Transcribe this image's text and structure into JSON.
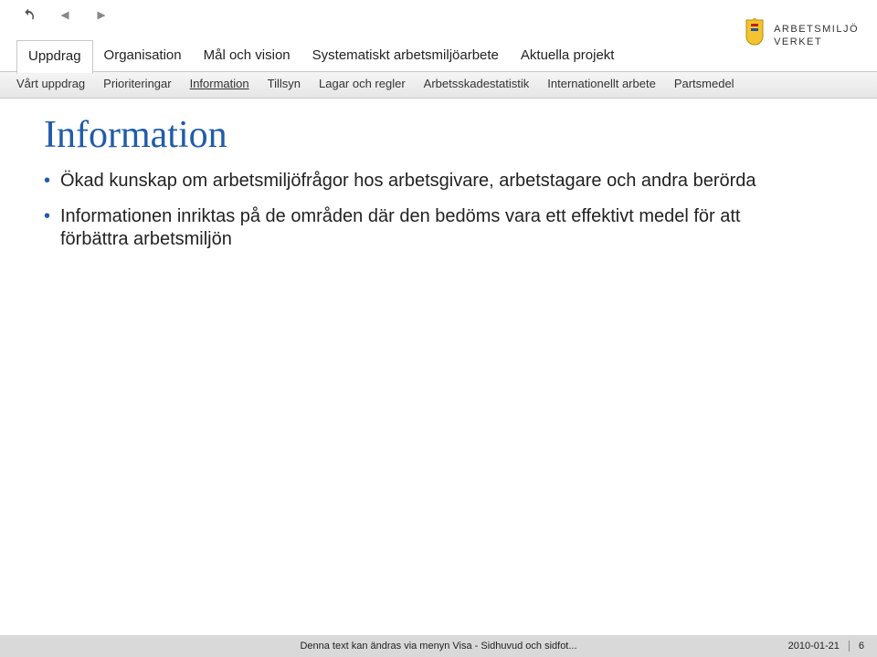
{
  "toolbar": {
    "undo_icon": "undo-icon",
    "prev_icon": "prev-icon",
    "next_icon": "next-icon"
  },
  "nav1": {
    "items": [
      {
        "label": "Uppdrag",
        "active": true
      },
      {
        "label": "Organisation",
        "active": false
      },
      {
        "label": "Mål och vision",
        "active": false
      },
      {
        "label": "Systematiskt arbetsmiljöarbete",
        "active": false
      },
      {
        "label": "Aktuella projekt",
        "active": false
      }
    ]
  },
  "nav2": {
    "items": [
      {
        "label": "Vårt uppdrag",
        "active": false
      },
      {
        "label": "Prioriteringar",
        "active": false
      },
      {
        "label": "Information",
        "active": true
      },
      {
        "label": "Tillsyn",
        "active": false
      },
      {
        "label": "Lagar och regler",
        "active": false
      },
      {
        "label": "Arbetsskadestatistik",
        "active": false
      },
      {
        "label": "Internationellt arbete",
        "active": false
      },
      {
        "label": "Partsmedel",
        "active": false
      }
    ]
  },
  "logo": {
    "line1": "ARBETSMILJÖ",
    "line2": "VERKET"
  },
  "title": "Information",
  "bullets": [
    "Ökad kunskap om arbetsmiljöfrågor hos arbetsgivare, arbetstagare och andra berörda",
    "Informationen inriktas på de områden där den bedöms vara ett effektivt medel för att förbättra arbetsmiljön"
  ],
  "footer": {
    "center": "Denna text kan ändras via menyn Visa - Sidhuvud och sidfot...",
    "date": "2010-01-21",
    "page": "6"
  }
}
